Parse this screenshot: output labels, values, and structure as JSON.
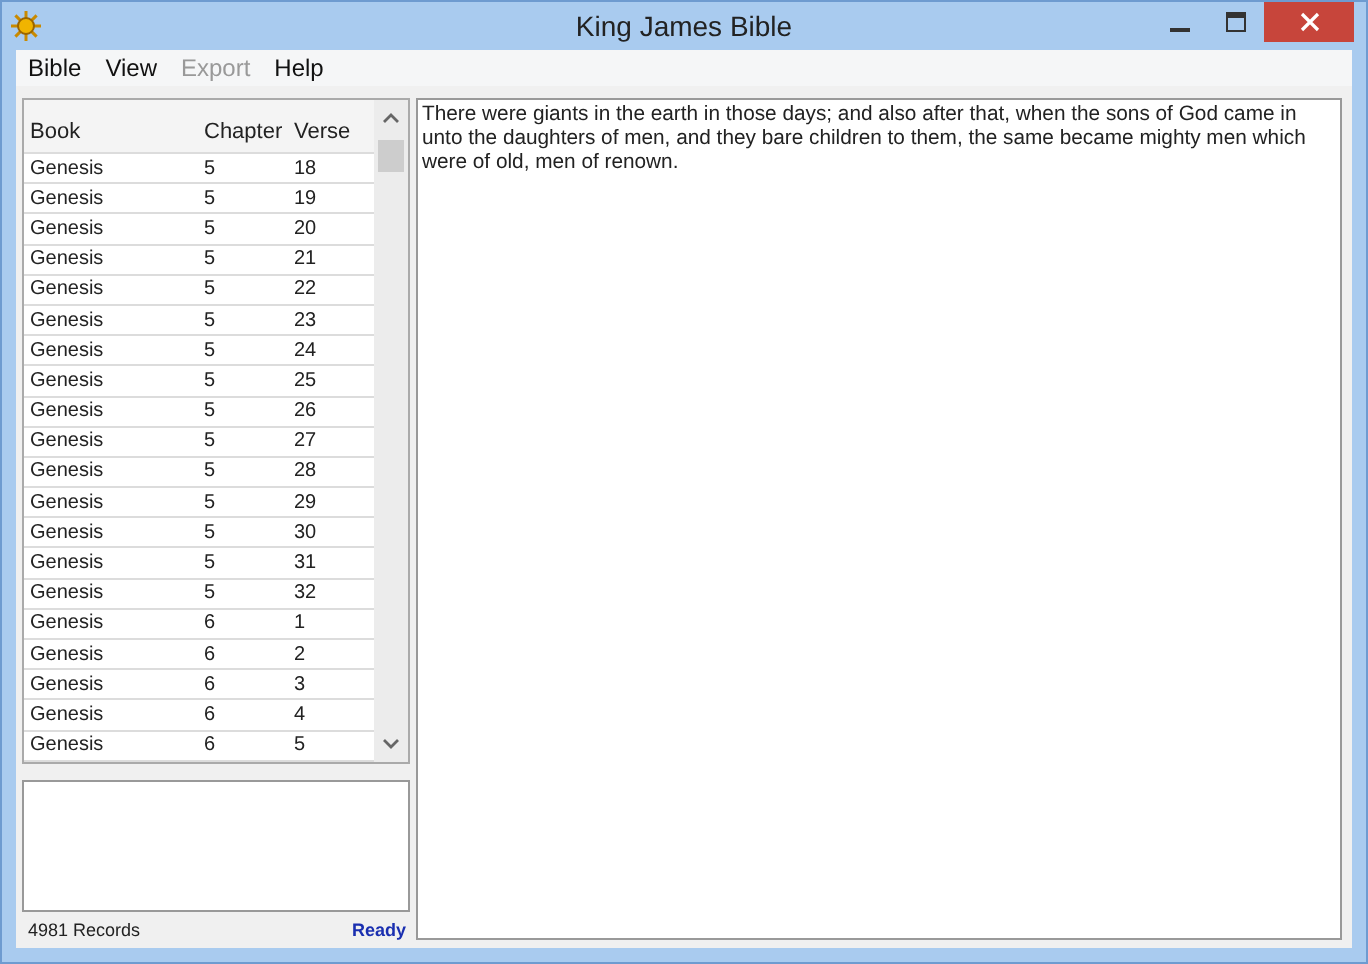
{
  "window": {
    "title": "King James Bible"
  },
  "menu": [
    {
      "label": "Bible",
      "disabled": false
    },
    {
      "label": "View",
      "disabled": false
    },
    {
      "label": "Export",
      "disabled": true
    },
    {
      "label": "Help",
      "disabled": false
    }
  ],
  "table": {
    "columns": [
      "Book",
      "Chapter",
      "Verse"
    ],
    "rows": [
      [
        "Genesis",
        "5",
        "18"
      ],
      [
        "Genesis",
        "5",
        "19"
      ],
      [
        "Genesis",
        "5",
        "20"
      ],
      [
        "Genesis",
        "5",
        "21"
      ],
      [
        "Genesis",
        "5",
        "22"
      ],
      [
        "Genesis",
        "5",
        "23"
      ],
      [
        "Genesis",
        "5",
        "24"
      ],
      [
        "Genesis",
        "5",
        "25"
      ],
      [
        "Genesis",
        "5",
        "26"
      ],
      [
        "Genesis",
        "5",
        "27"
      ],
      [
        "Genesis",
        "5",
        "28"
      ],
      [
        "Genesis",
        "5",
        "29"
      ],
      [
        "Genesis",
        "5",
        "30"
      ],
      [
        "Genesis",
        "5",
        "31"
      ],
      [
        "Genesis",
        "5",
        "32"
      ],
      [
        "Genesis",
        "6",
        "1"
      ],
      [
        "Genesis",
        "6",
        "2"
      ],
      [
        "Genesis",
        "6",
        "3"
      ],
      [
        "Genesis",
        "6",
        "4"
      ],
      [
        "Genesis",
        "6",
        "5"
      ]
    ]
  },
  "verse_text": "There were giants in the earth in those days; and also after that, when the sons of God came in unto the daughters of men, and they bare children to them, the same became mighty men which were of old, men of renown.",
  "status_bar": {
    "records": "4981 Records",
    "status": "Ready"
  }
}
